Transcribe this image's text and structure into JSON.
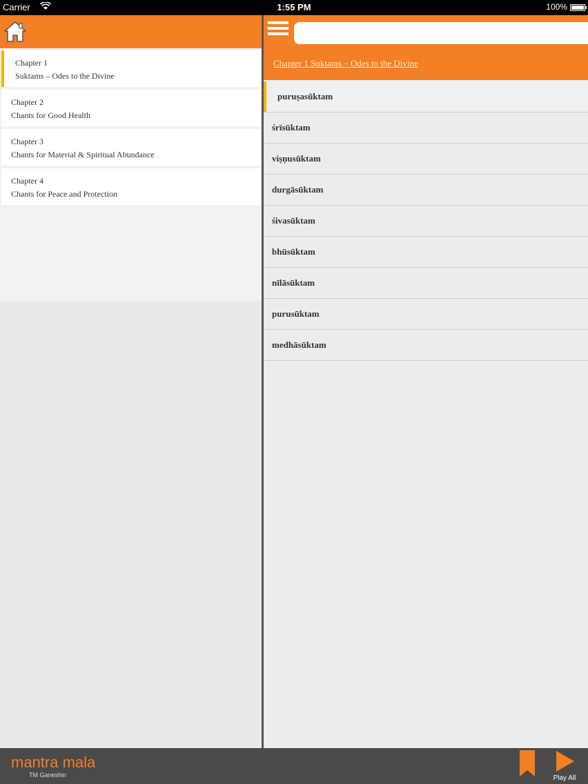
{
  "status_bar": {
    "carrier": "Carrier",
    "time": "1:55 PM",
    "battery": "100%"
  },
  "chapters": [
    {
      "number": "Chapter 1",
      "title": "Suktams – Odes to the Divine"
    },
    {
      "number": "Chapter 2",
      "title": "Chants for Good Health"
    },
    {
      "number": "Chapter 3",
      "title": "Chants for Material & Spiritual Abundance"
    },
    {
      "number": "Chapter 4",
      "title": "Chants for Peace and Protection"
    }
  ],
  "search": {
    "value": "",
    "placeholder": ""
  },
  "current_chapter_title": "Chapter 1 Suktams – Odes to the Divine",
  "mantras": [
    "puruṣasūktam",
    "śrīsūktam",
    "viṣṇusūktam",
    "durgāsūktam",
    "śivasūktam",
    "bhūsūktam",
    "nīlāsūktam",
    "purusūktam",
    "medhāsūktam"
  ],
  "footer": {
    "logo": "mantra mala",
    "logo_sub": "TM Ganeshin",
    "play_label": "Play All"
  },
  "colors": {
    "accent": "#f47f24",
    "highlight": "#f4b400",
    "footer_bg": "#4a4a4a"
  }
}
